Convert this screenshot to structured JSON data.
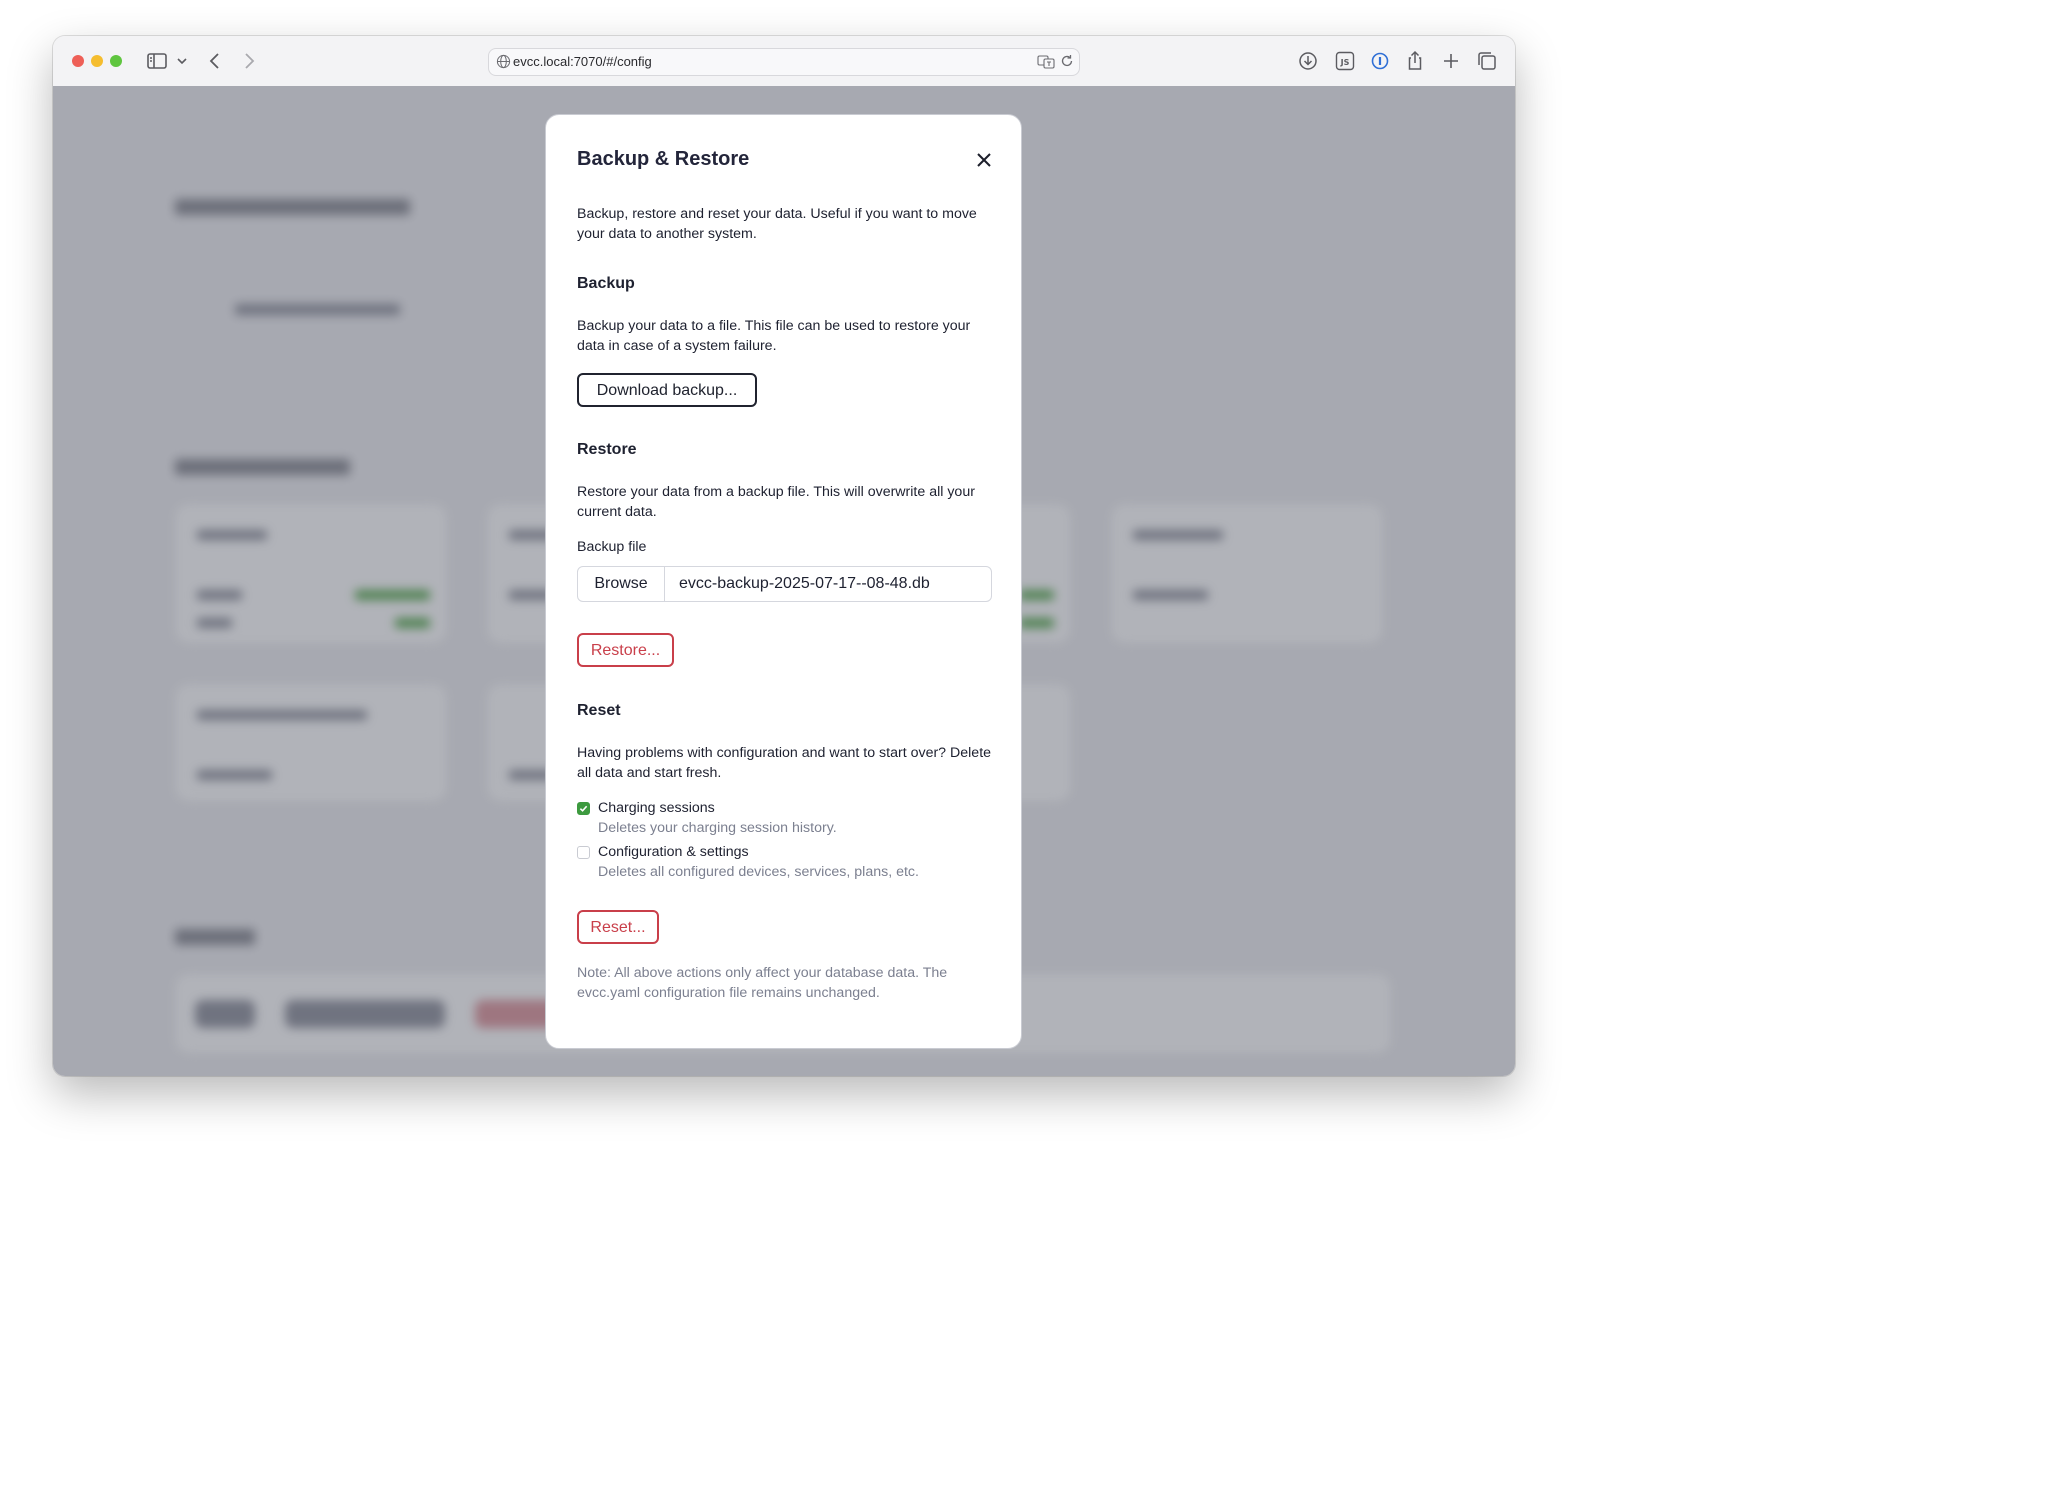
{
  "browser": {
    "url": "evcc.local:7070/#/config"
  },
  "modal": {
    "title": "Backup & Restore",
    "intro": "Backup, restore and reset your data. Useful if you want to move your data to another system.",
    "backup": {
      "title": "Backup",
      "description": "Backup your data to a file. This file can be used to restore your data in case of a system failure.",
      "button": "Download backup..."
    },
    "restore": {
      "title": "Restore",
      "description": "Restore your data from a backup file. This will overwrite all your current data.",
      "file_label": "Backup file",
      "browse_label": "Browse",
      "file_name": "evcc-backup-2025-07-17--08-48.db",
      "button": "Restore..."
    },
    "reset": {
      "title": "Reset",
      "description": "Having problems with configuration and want to start over? Delete all data and start fresh.",
      "options": [
        {
          "label": "Charging sessions",
          "description": "Deletes your charging session history.",
          "checked": true
        },
        {
          "label": "Configuration & settings",
          "description": "Deletes all configured devices, services, plans, etc.",
          "checked": false
        }
      ],
      "button": "Reset..."
    },
    "note": "Note: All above actions only affect your database data. The evcc.yaml configuration file remains unchanged."
  },
  "colors": {
    "danger": "#c93f4a",
    "success": "#3d9a3f",
    "overlay": "rgba(40,44,60,0.36)"
  }
}
